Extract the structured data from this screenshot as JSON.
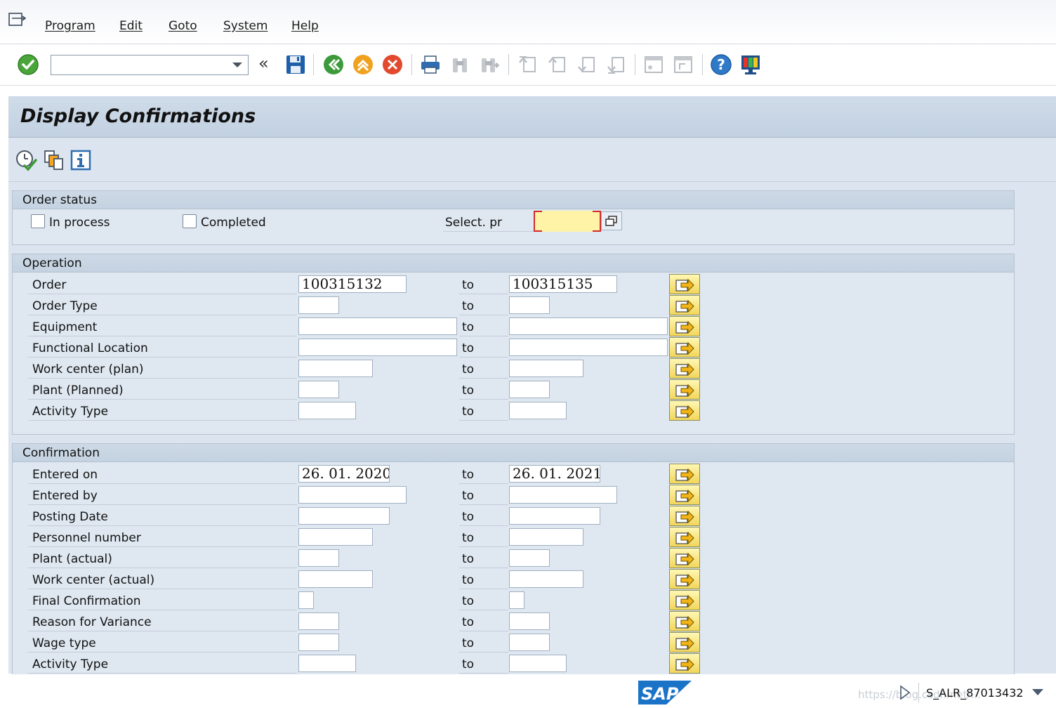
{
  "menu": {
    "icon": "menu-exit-icon",
    "items": [
      {
        "id": "program",
        "label": "Program"
      },
      {
        "id": "edit",
        "label": "Edit"
      },
      {
        "id": "goto",
        "label": "Goto"
      },
      {
        "id": "system",
        "label": "System"
      },
      {
        "id": "help",
        "label": "Help"
      }
    ]
  },
  "toolbar": {
    "command_field_value": "",
    "icons": [
      "enter-icon",
      "command-field-dropdown-icon",
      "collapse-chevron-icon",
      "save-icon",
      "back-icon",
      "exit-icon",
      "cancel-icon",
      "print-icon",
      "find-icon",
      "find-next-icon",
      "first-page-icon",
      "previous-page-icon",
      "next-page-icon",
      "last-page-icon",
      "create-session-icon",
      "shortcut-icon",
      "help-icon",
      "customize-layout-icon"
    ],
    "collapse_glyph": "«"
  },
  "page": {
    "title": "Display Confirmations",
    "app_icons": [
      "execute-icon",
      "get-variant-icon",
      "program-documentation-icon"
    ]
  },
  "order_status": {
    "title": "Order status",
    "in_process_label": "In process",
    "in_process_checked": false,
    "completed_label": "Completed",
    "completed_checked": false,
    "select_profile_label": "Select. pr",
    "select_profile_value": ""
  },
  "operation": {
    "title": "Operation",
    "to_label": "to",
    "rows": [
      {
        "label": "Order",
        "from": "100315132",
        "to": "100315135"
      },
      {
        "label": "Order Type",
        "from": "",
        "to": ""
      },
      {
        "label": "Equipment",
        "from": "",
        "to": ""
      },
      {
        "label": "Functional Location",
        "from": "",
        "to": ""
      },
      {
        "label": "Work center (plan)",
        "from": "",
        "to": ""
      },
      {
        "label": "Plant (Planned)",
        "from": "",
        "to": ""
      },
      {
        "label": "Activity Type",
        "from": "",
        "to": ""
      }
    ]
  },
  "confirmation": {
    "title": "Confirmation",
    "to_label": "to",
    "rows": [
      {
        "label": "Entered on",
        "from": "26. 01. 2020",
        "to": "26. 01. 2021"
      },
      {
        "label": "Entered by",
        "from": "",
        "to": ""
      },
      {
        "label": "Posting Date",
        "from": "",
        "to": ""
      },
      {
        "label": "Personnel number",
        "from": "",
        "to": ""
      },
      {
        "label": "Plant (actual)",
        "from": "",
        "to": ""
      },
      {
        "label": "Work center (actual)",
        "from": "",
        "to": ""
      },
      {
        "label": "Final Confirmation",
        "from": "",
        "to": ""
      },
      {
        "label": "Reason for Variance",
        "from": "",
        "to": ""
      },
      {
        "label": "Wage type",
        "from": "",
        "to": ""
      },
      {
        "label": "Activity Type",
        "from": "",
        "to": ""
      }
    ]
  },
  "status_bar": {
    "logo_text": "SAP",
    "transaction": "S_ALR_87013432",
    "watermark": "https://blog.csdn.net/..."
  }
}
